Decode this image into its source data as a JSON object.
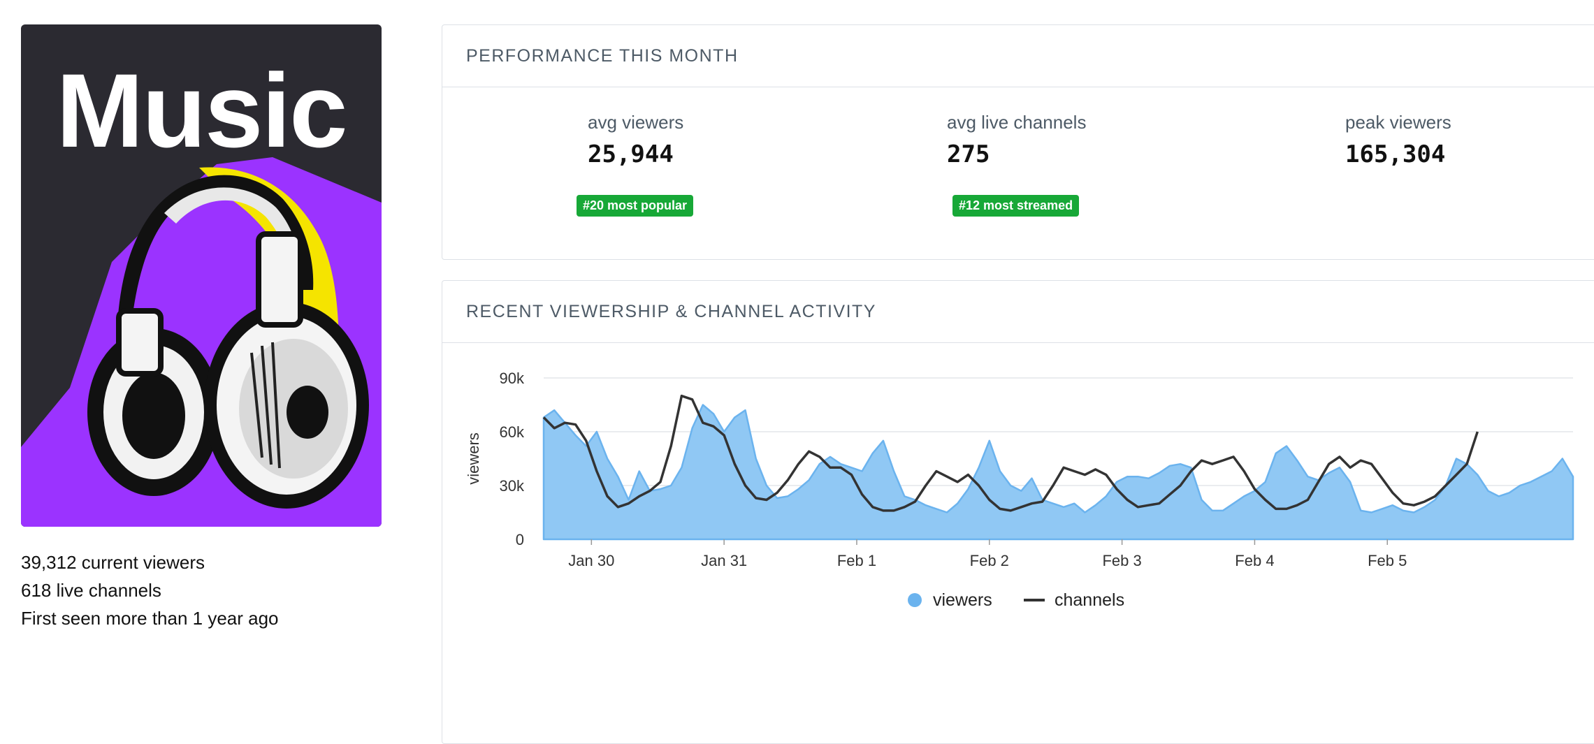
{
  "category": {
    "title": "Music",
    "current_viewers": "39,312 current viewers",
    "live_channels": "618 live channels",
    "first_seen": "First seen more than 1 year ago"
  },
  "performance": {
    "header": "PERFORMANCE THIS MONTH",
    "avg_viewers_label": "avg viewers",
    "avg_viewers_value": "25,944",
    "avg_viewers_badge": "#20 most popular",
    "avg_channels_label": "avg live channels",
    "avg_channels_value": "275",
    "avg_channels_badge": "#12 most streamed",
    "peak_viewers_label": "peak viewers",
    "peak_viewers_value": "165,304"
  },
  "activity": {
    "header": "RECENT VIEWERSHIP & CHANNEL ACTIVITY"
  },
  "colors": {
    "badge": "#17a837",
    "viewers_fill": "#90c8f4",
    "viewers_line": "#6bb3ee",
    "channels_line": "#333333",
    "cover_bg": "#2b2a31",
    "cover_purple": "#9b33ff",
    "cover_yellow": "#f5e400"
  },
  "chart_data": {
    "type": "area",
    "ylabel": "viewers",
    "yticks": [
      "0",
      "30k",
      "60k",
      "90k"
    ],
    "ylim": [
      0,
      90000
    ],
    "xticks": [
      "Jan 30",
      "Jan 31",
      "Feb 1",
      "Feb 2",
      "Feb 3",
      "Feb 4",
      "Feb 5"
    ],
    "x": [
      -0.36,
      -0.28,
      -0.2,
      -0.12,
      -0.04,
      0.04,
      0.12,
      0.2,
      0.28,
      0.36,
      0.44,
      0.52,
      0.6,
      0.68,
      0.76,
      0.84,
      0.92,
      1.0,
      1.08,
      1.16,
      1.24,
      1.32,
      1.4,
      1.48,
      1.56,
      1.64,
      1.72,
      1.8,
      1.88,
      1.96,
      2.04,
      2.12,
      2.2,
      2.28,
      2.36,
      2.44,
      2.52,
      2.6,
      2.68,
      2.76,
      2.84,
      2.92,
      3.0,
      3.08,
      3.16,
      3.24,
      3.32,
      3.4,
      3.48,
      3.56,
      3.64,
      3.72,
      3.8,
      3.88,
      3.96,
      4.04,
      4.12,
      4.2,
      4.28,
      4.36,
      4.44,
      4.52,
      4.6,
      4.68,
      4.76,
      4.84,
      4.92,
      5.0,
      5.08,
      5.16,
      5.24,
      5.32,
      5.4,
      5.48,
      5.56,
      5.64,
      5.72,
      5.8,
      5.88,
      5.96,
      6.04,
      6.12,
      6.2,
      6.28,
      6.36,
      6.44,
      6.52,
      6.6,
      6.68,
      6.76,
      6.84,
      6.92,
      7.0,
      7.08,
      7.16,
      7.24,
      7.32,
      7.4
    ],
    "series": [
      {
        "name": "viewers",
        "values": [
          68000,
          72000,
          65000,
          58000,
          52000,
          60000,
          45000,
          35000,
          22000,
          38000,
          27000,
          28000,
          30000,
          40000,
          62000,
          75000,
          70000,
          60000,
          68000,
          72000,
          45000,
          30000,
          23000,
          24000,
          28000,
          33000,
          42000,
          46000,
          42000,
          40000,
          38000,
          48000,
          55000,
          38000,
          24000,
          22000,
          19000,
          17000,
          15000,
          20000,
          28000,
          40000,
          55000,
          38000,
          30000,
          27000,
          34000,
          22000,
          20000,
          18000,
          20000,
          15000,
          19000,
          24000,
          32000,
          35000,
          35000,
          34000,
          37000,
          41000,
          42000,
          40000,
          22000,
          16000,
          16000,
          20000,
          24000,
          27000,
          32000,
          48000,
          52000,
          44000,
          35000,
          33000,
          37000,
          40000,
          32000,
          16000,
          15000,
          17000,
          19000,
          16000,
          15000,
          18000,
          22000,
          30000,
          45000,
          42000,
          36000,
          27000,
          24000,
          26000,
          30000,
          32000,
          35000,
          38000,
          45000,
          35000
        ]
      },
      {
        "name": "channels",
        "values": [
          68000,
          62000,
          65000,
          64000,
          55000,
          38000,
          24000,
          18000,
          20000,
          24000,
          27000,
          32000,
          52000,
          80000,
          78000,
          65000,
          63000,
          58000,
          42000,
          30000,
          23000,
          22000,
          26000,
          33000,
          42000,
          49000,
          46000,
          40000,
          40000,
          36000,
          25000,
          18000,
          16000,
          16000,
          18000,
          21000,
          30000,
          38000,
          35000,
          32000,
          36000,
          30000,
          22000,
          17000,
          16000,
          18000,
          20000,
          21000,
          30000,
          40000,
          38000,
          36000,
          39000,
          36000,
          28000,
          22000,
          18000,
          19000,
          20000,
          25000,
          30000,
          38000,
          44000,
          42000,
          44000,
          46000,
          38000,
          28000,
          22000,
          17000,
          17000,
          19000,
          22000,
          32000,
          42000,
          46000,
          40000,
          44000,
          42000,
          34000,
          26000,
          20000,
          19000,
          21000,
          24000,
          30000,
          36000,
          42000,
          60000
        ]
      }
    ],
    "legend": [
      "viewers",
      "channels"
    ],
    "legend_position": "bottom-center",
    "grid": true
  }
}
